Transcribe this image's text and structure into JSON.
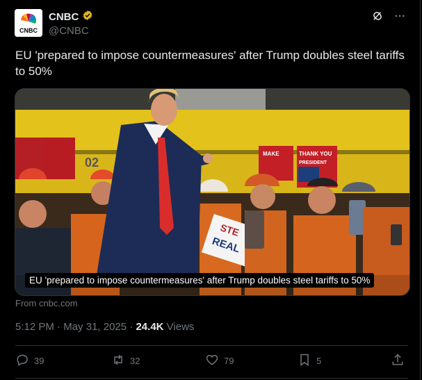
{
  "account": {
    "display_name": "CNBC",
    "handle": "@CNBC",
    "logo_text": "CNBC"
  },
  "tweet": {
    "text": "EU 'prepared to impose countermeasures' after Trump doubles steel tariffs to 50%",
    "media_caption": "EU 'prepared to impose countermeasures' after Trump doubles steel tariffs to 50%",
    "source": "From cnbc.com",
    "time": "5:12 PM",
    "date": "May 31, 2025",
    "views": "24.4K",
    "views_label": "Views"
  },
  "sign_texts": {
    "make": "MAKE",
    "thank_you": "THANK YOU",
    "president": "PRESIDENT",
    "steel": "STE",
    "real": "REAL",
    "number": "02"
  },
  "actions": {
    "replies": "39",
    "reposts": "32",
    "likes": "79",
    "bookmarks": "5"
  },
  "colors": {
    "verified_badge": "#e2b719",
    "background": "#000000",
    "muted_text": "#71767b",
    "primary_text": "#e7e9ea"
  },
  "icons": [
    "grok-icon",
    "more-icon",
    "reply-icon",
    "repost-icon",
    "like-icon",
    "bookmark-icon",
    "share-icon",
    "verified-badge-icon"
  ]
}
